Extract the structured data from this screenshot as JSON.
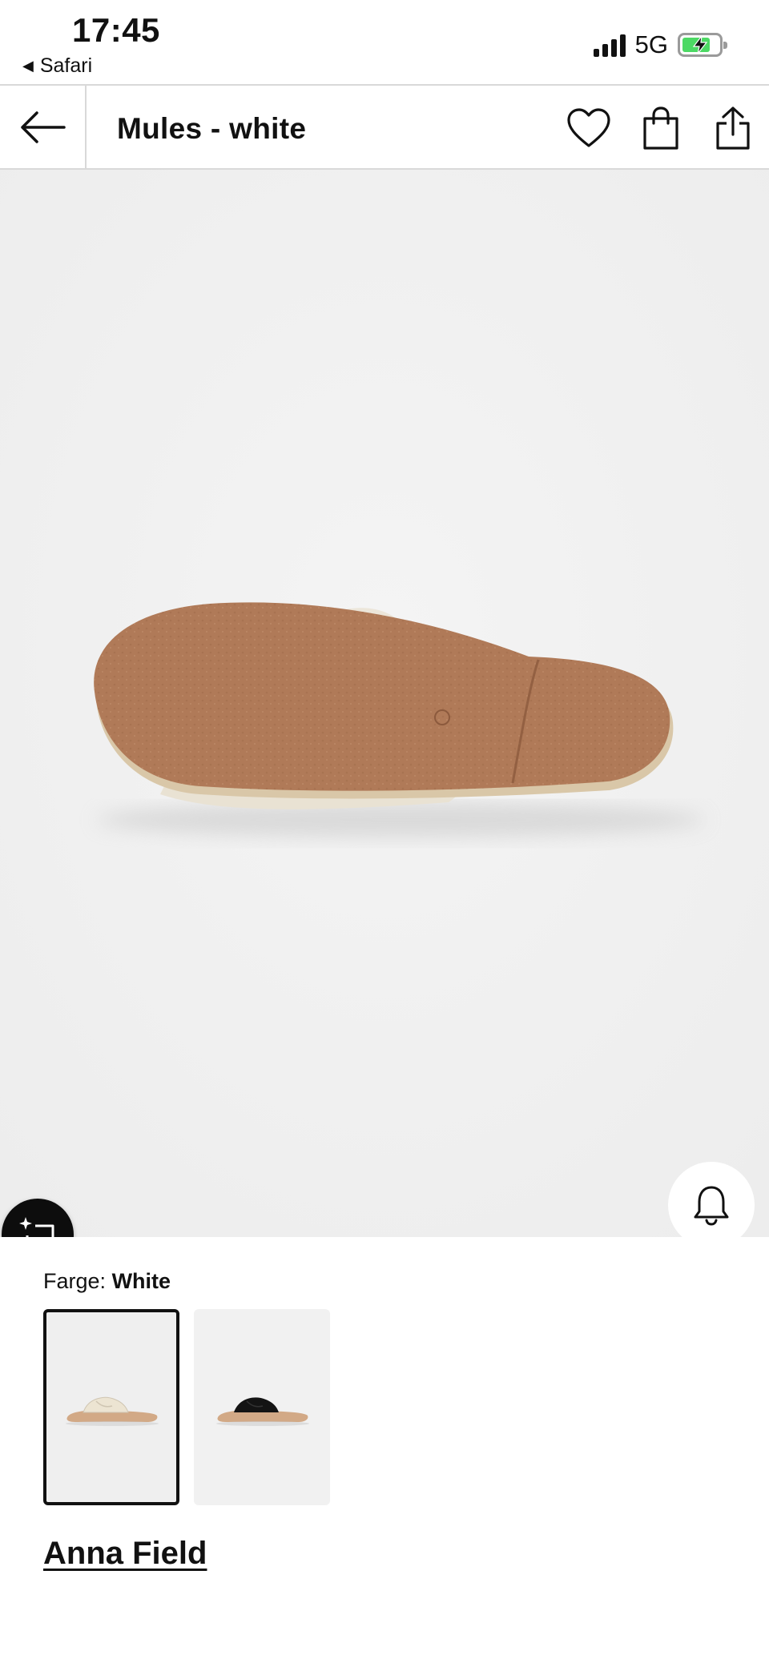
{
  "status_bar": {
    "time": "17:45",
    "back_app": "Safari",
    "network": "5G",
    "battery_charging": true
  },
  "nav": {
    "title": "Mules - white",
    "icons": [
      "back-arrow-icon",
      "heart-icon",
      "shopping-bag-icon",
      "share-icon"
    ]
  },
  "product": {
    "floating_actions": [
      "bell-icon",
      "heart-icon",
      "shopping-bag-icon"
    ],
    "ai_button_icon": "sparkle-chat-icon"
  },
  "details": {
    "color_label": "Farge:",
    "color_value": "White",
    "variants": [
      {
        "color": "white",
        "selected": true
      },
      {
        "color": "black",
        "selected": false
      }
    ],
    "brand": "Anna Field"
  },
  "colors": {
    "background": "#ffffff",
    "image_bg": "#f0f0f0",
    "sole": "#b07a58",
    "accent_dark": "#0d0d0d",
    "battery_green": "#4cd964"
  }
}
